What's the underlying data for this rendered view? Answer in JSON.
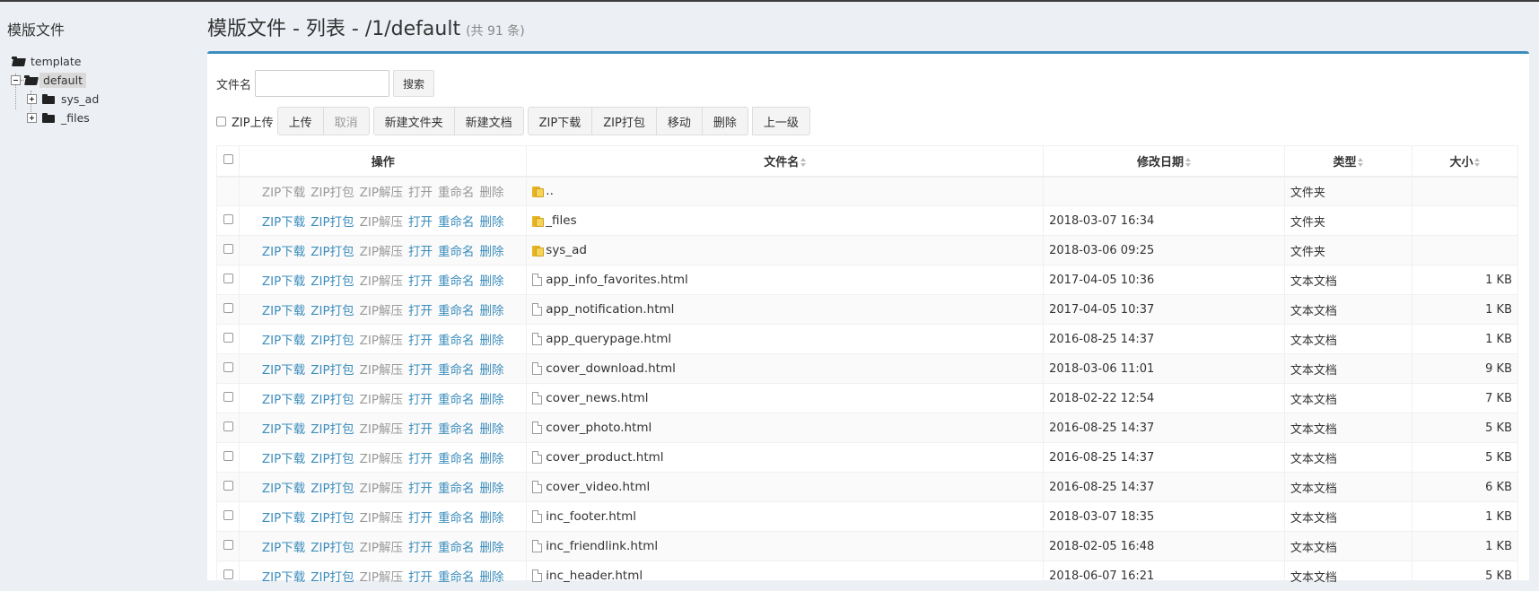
{
  "sidebar": {
    "title": "模版文件",
    "tree": {
      "root": "template",
      "current": "default",
      "children": [
        "sys_ad",
        "_files"
      ]
    }
  },
  "header": {
    "title": "模版文件 - 列表 - /1/default",
    "count": "(共 91 条)"
  },
  "search": {
    "label": "文件名",
    "value": "",
    "placeholder": "",
    "button": "搜索"
  },
  "toolbar": {
    "zip_upload_label": "ZIP上传",
    "upload": "上传",
    "cancel": "取消",
    "new_folder": "新建文件夹",
    "new_document": "新建文档",
    "zip_download": "ZIP下载",
    "zip_pack": "ZIP打包",
    "move": "移动",
    "delete": "删除",
    "up_level": "上一级"
  },
  "table": {
    "columns": {
      "actions": "操作",
      "name": "文件名",
      "modified": "修改日期",
      "type": "类型",
      "size": "大小"
    },
    "action_labels": [
      "ZIP下载",
      "ZIP打包",
      "ZIP解压",
      "打开",
      "重命名",
      "删除"
    ],
    "rows": [
      {
        "name": "..",
        "date": "",
        "type": "文件夹",
        "size": "",
        "kind": "dir",
        "parent": true
      },
      {
        "name": "_files",
        "date": "2018-03-07 16:34",
        "type": "文件夹",
        "size": "",
        "kind": "dir"
      },
      {
        "name": "sys_ad",
        "date": "2018-03-06 09:25",
        "type": "文件夹",
        "size": "",
        "kind": "dir"
      },
      {
        "name": "app_info_favorites.html",
        "date": "2017-04-05 10:36",
        "type": "文本文档",
        "size": "1 KB",
        "kind": "file"
      },
      {
        "name": "app_notification.html",
        "date": "2017-04-05 10:37",
        "type": "文本文档",
        "size": "1 KB",
        "kind": "file"
      },
      {
        "name": "app_querypage.html",
        "date": "2016-08-25 14:37",
        "type": "文本文档",
        "size": "1 KB",
        "kind": "file"
      },
      {
        "name": "cover_download.html",
        "date": "2018-03-06 11:01",
        "type": "文本文档",
        "size": "9 KB",
        "kind": "file"
      },
      {
        "name": "cover_news.html",
        "date": "2018-02-22 12:54",
        "type": "文本文档",
        "size": "7 KB",
        "kind": "file"
      },
      {
        "name": "cover_photo.html",
        "date": "2016-08-25 14:37",
        "type": "文本文档",
        "size": "5 KB",
        "kind": "file"
      },
      {
        "name": "cover_product.html",
        "date": "2016-08-25 14:37",
        "type": "文本文档",
        "size": "5 KB",
        "kind": "file"
      },
      {
        "name": "cover_video.html",
        "date": "2016-08-25 14:37",
        "type": "文本文档",
        "size": "6 KB",
        "kind": "file"
      },
      {
        "name": "inc_footer.html",
        "date": "2018-03-07 18:35",
        "type": "文本文档",
        "size": "1 KB",
        "kind": "file"
      },
      {
        "name": "inc_friendlink.html",
        "date": "2018-02-05 16:48",
        "type": "文本文档",
        "size": "1 KB",
        "kind": "file"
      },
      {
        "name": "inc_header.html",
        "date": "2018-06-07 16:21",
        "type": "文本文档",
        "size": "5 KB",
        "kind": "file"
      }
    ]
  },
  "colors": {
    "accent": "#3c8dbc",
    "background": "#ecf0f5",
    "disabled_text": "#999999"
  }
}
